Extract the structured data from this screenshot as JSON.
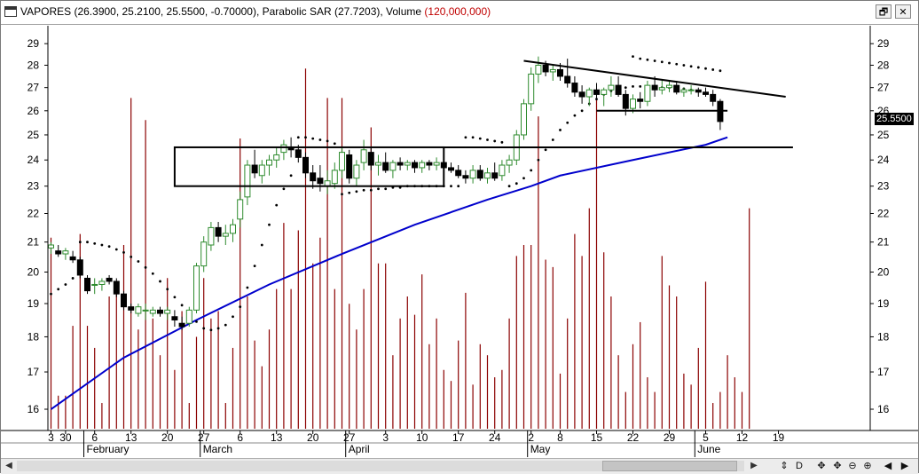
{
  "window": {
    "title_prefix": "VAPORES (26.3900, 25.2100, 25.5500, -0.70000), Parabolic SAR (27.7203), Volume ",
    "title_volume": "(120,000,000)",
    "restore_label": "🗗",
    "close_label": "✕"
  },
  "price_tag": "25.5500",
  "scrollbar": {
    "left_label": "◀",
    "right_label": "▶",
    "tools": [
      "⇕",
      "D",
      "✥",
      "✥",
      "⊖",
      "⊕",
      "◀",
      "▶"
    ]
  },
  "chart_data": {
    "type": "candlestick",
    "ylim": [
      15.5,
      29.6
    ],
    "y_scale": "log",
    "y_ticks": [
      16,
      17,
      18,
      19,
      20,
      21,
      22,
      23,
      24,
      25,
      26,
      27,
      28,
      29
    ],
    "y_ticks_right": [
      16,
      17,
      18,
      19,
      20,
      21,
      22,
      23,
      24,
      25,
      26,
      27,
      28,
      29
    ],
    "x_tick_labels": [
      "3",
      "30",
      "6",
      "13",
      "20",
      "27",
      "6",
      "13",
      "20",
      "27",
      "3",
      "10",
      "17",
      "24",
      "2",
      "8",
      "15",
      "22",
      "29",
      "5",
      "12",
      "19"
    ],
    "x_tick_bars": [
      0,
      2,
      6,
      11,
      16,
      21,
      26,
      31,
      36,
      41,
      46,
      51,
      56,
      61,
      66,
      70,
      75,
      80,
      85,
      90,
      95,
      100
    ],
    "months": [
      {
        "label": "February",
        "bar": 5
      },
      {
        "label": "March",
        "bar": 21
      },
      {
        "label": "April",
        "bar": 41
      },
      {
        "label": "May",
        "bar": 66
      },
      {
        "label": "June",
        "bar": 89
      }
    ],
    "series": [
      {
        "name": "VAPORES",
        "ohlc": [
          [
            20.8,
            21.0,
            20.6,
            20.9
          ],
          [
            20.7,
            20.9,
            20.5,
            20.6
          ],
          [
            20.6,
            20.8,
            20.4,
            20.7
          ],
          [
            20.5,
            20.7,
            20.3,
            20.4
          ],
          [
            20.4,
            20.5,
            19.8,
            19.9
          ],
          [
            19.8,
            19.9,
            19.3,
            19.4
          ],
          [
            19.6,
            19.8,
            19.3,
            19.6
          ],
          [
            19.6,
            19.8,
            19.4,
            19.7
          ],
          [
            19.8,
            19.9,
            19.6,
            19.7
          ],
          [
            19.7,
            19.8,
            19.2,
            19.3
          ],
          [
            19.3,
            19.4,
            18.8,
            18.9
          ],
          [
            18.9,
            19.0,
            18.7,
            18.8
          ],
          [
            18.7,
            19.0,
            18.6,
            18.9
          ],
          [
            18.8,
            19.0,
            18.5,
            18.8
          ],
          [
            18.7,
            18.9,
            18.6,
            18.8
          ],
          [
            18.8,
            18.9,
            18.6,
            18.7
          ],
          [
            18.7,
            18.9,
            18.5,
            18.8
          ],
          [
            18.6,
            18.8,
            18.3,
            18.5
          ],
          [
            18.4,
            18.6,
            18.2,
            18.3
          ],
          [
            18.4,
            18.9,
            18.3,
            18.8
          ],
          [
            18.8,
            20.3,
            18.7,
            20.2
          ],
          [
            20.2,
            21.2,
            20.0,
            21.0
          ],
          [
            20.9,
            21.7,
            20.7,
            21.5
          ],
          [
            21.5,
            21.7,
            21.0,
            21.2
          ],
          [
            21.2,
            21.6,
            20.9,
            21.3
          ],
          [
            21.3,
            21.8,
            21.0,
            21.6
          ],
          [
            21.8,
            22.8,
            21.5,
            22.5
          ],
          [
            22.6,
            24.0,
            22.3,
            23.8
          ],
          [
            23.8,
            24.4,
            23.3,
            23.5
          ],
          [
            23.4,
            24.0,
            23.1,
            23.8
          ],
          [
            23.8,
            24.2,
            23.4,
            24.0
          ],
          [
            24.0,
            24.5,
            23.7,
            24.2
          ],
          [
            24.3,
            24.8,
            24.0,
            24.6
          ],
          [
            24.5,
            24.9,
            24.1,
            24.4
          ],
          [
            24.4,
            24.6,
            23.9,
            24.1
          ],
          [
            24.1,
            24.3,
            23.3,
            23.5
          ],
          [
            23.5,
            23.8,
            22.9,
            23.2
          ],
          [
            23.3,
            23.8,
            22.8,
            23.1
          ],
          [
            23.0,
            23.6,
            22.7,
            23.2
          ],
          [
            23.1,
            23.9,
            22.9,
            23.6
          ],
          [
            23.6,
            24.5,
            23.3,
            24.3
          ],
          [
            24.2,
            24.4,
            23.1,
            23.3
          ],
          [
            23.3,
            24.0,
            23.0,
            23.8
          ],
          [
            23.9,
            24.8,
            23.6,
            24.4
          ],
          [
            24.3,
            24.5,
            23.6,
            23.8
          ],
          [
            23.8,
            24.2,
            23.4,
            23.9
          ],
          [
            23.9,
            24.3,
            23.5,
            23.6
          ],
          [
            23.6,
            24.0,
            23.3,
            23.9
          ],
          [
            23.9,
            24.1,
            23.6,
            23.8
          ],
          [
            23.8,
            24.0,
            23.6,
            23.9
          ],
          [
            23.9,
            24.0,
            23.5,
            23.7
          ],
          [
            23.7,
            24.0,
            23.5,
            23.9
          ],
          [
            23.9,
            24.0,
            23.6,
            23.8
          ],
          [
            23.8,
            24.1,
            23.6,
            23.9
          ],
          [
            23.9,
            24.0,
            23.6,
            23.7
          ],
          [
            23.7,
            23.9,
            23.5,
            23.6
          ],
          [
            23.6,
            23.8,
            23.3,
            23.4
          ],
          [
            23.4,
            23.6,
            23.1,
            23.3
          ],
          [
            23.3,
            23.8,
            23.1,
            23.6
          ],
          [
            23.6,
            23.8,
            23.2,
            23.3
          ],
          [
            23.3,
            23.7,
            23.1,
            23.5
          ],
          [
            23.5,
            23.9,
            23.2,
            23.3
          ],
          [
            23.4,
            24.0,
            23.2,
            23.8
          ],
          [
            23.8,
            24.2,
            23.5,
            24.0
          ],
          [
            24.0,
            25.2,
            23.8,
            25.0
          ],
          [
            25.0,
            26.5,
            24.8,
            26.3
          ],
          [
            26.3,
            27.9,
            26.0,
            27.6
          ],
          [
            27.6,
            28.4,
            27.2,
            28.0
          ],
          [
            28.0,
            28.2,
            27.5,
            27.7
          ],
          [
            27.7,
            28.0,
            27.3,
            27.8
          ],
          [
            27.8,
            28.1,
            27.3,
            27.5
          ],
          [
            27.5,
            28.3,
            27.0,
            27.2
          ],
          [
            27.2,
            27.5,
            26.6,
            26.8
          ],
          [
            26.8,
            27.1,
            26.3,
            26.6
          ],
          [
            26.6,
            27.0,
            26.2,
            26.9
          ],
          [
            26.9,
            27.2,
            26.5,
            26.7
          ],
          [
            26.7,
            27.0,
            26.2,
            26.9
          ],
          [
            26.9,
            27.5,
            26.6,
            27.1
          ],
          [
            27.1,
            27.5,
            26.6,
            26.7
          ],
          [
            26.7,
            26.9,
            25.8,
            26.1
          ],
          [
            26.1,
            26.7,
            25.9,
            26.5
          ],
          [
            26.5,
            26.8,
            26.1,
            26.4
          ],
          [
            26.4,
            27.3,
            26.2,
            27.1
          ],
          [
            27.1,
            27.5,
            26.6,
            26.9
          ],
          [
            26.9,
            27.3,
            26.7,
            27.0
          ],
          [
            27.0,
            27.3,
            26.8,
            27.1
          ],
          [
            27.1,
            27.3,
            26.7,
            26.8
          ],
          [
            26.8,
            27.0,
            26.6,
            26.9
          ],
          [
            26.9,
            27.1,
            26.7,
            26.9
          ],
          [
            26.9,
            27.0,
            26.6,
            26.8
          ],
          [
            26.8,
            27.0,
            26.6,
            26.7
          ],
          [
            26.7,
            26.9,
            26.2,
            26.4
          ],
          [
            26.4,
            26.5,
            25.2,
            25.55
          ]
        ]
      },
      {
        "name": "Parabolic SAR",
        "points": [
          [
            0,
            19.3
          ],
          [
            1,
            19.45
          ],
          [
            2,
            19.6
          ],
          [
            3,
            19.8
          ],
          [
            4,
            21.0
          ],
          [
            5,
            21.0
          ],
          [
            6,
            20.95
          ],
          [
            7,
            20.9
          ],
          [
            8,
            20.85
          ],
          [
            9,
            20.75
          ],
          [
            10,
            20.65
          ],
          [
            11,
            20.5
          ],
          [
            12,
            20.35
          ],
          [
            13,
            20.15
          ],
          [
            14,
            19.95
          ],
          [
            15,
            19.7
          ],
          [
            16,
            19.45
          ],
          [
            17,
            19.2
          ],
          [
            18,
            18.95
          ],
          [
            19,
            18.7
          ],
          [
            20,
            18.45
          ],
          [
            21,
            18.25
          ],
          [
            22,
            18.2
          ],
          [
            23,
            18.25
          ],
          [
            24,
            18.35
          ],
          [
            25,
            18.6
          ],
          [
            26,
            18.9
          ],
          [
            27,
            19.5
          ],
          [
            28,
            20.2
          ],
          [
            29,
            20.9
          ],
          [
            30,
            21.6
          ],
          [
            31,
            22.3
          ],
          [
            32,
            22.9
          ],
          [
            33,
            23.4
          ],
          [
            34,
            24.9
          ],
          [
            35,
            24.9
          ],
          [
            36,
            24.85
          ],
          [
            37,
            24.8
          ],
          [
            38,
            24.75
          ],
          [
            39,
            24.65
          ],
          [
            40,
            22.7
          ],
          [
            41,
            22.75
          ],
          [
            42,
            22.8
          ],
          [
            43,
            22.85
          ],
          [
            44,
            22.85
          ],
          [
            45,
            22.9
          ],
          [
            46,
            22.9
          ],
          [
            47,
            22.95
          ],
          [
            48,
            22.95
          ],
          [
            49,
            23.0
          ],
          [
            50,
            23.0
          ],
          [
            51,
            23.0
          ],
          [
            52,
            23.0
          ],
          [
            53,
            23.0
          ],
          [
            54,
            23.0
          ],
          [
            55,
            23.0
          ],
          [
            56,
            23.0
          ],
          [
            57,
            24.9
          ],
          [
            58,
            24.9
          ],
          [
            59,
            24.85
          ],
          [
            60,
            24.8
          ],
          [
            61,
            24.75
          ],
          [
            62,
            24.7
          ],
          [
            63,
            23.0
          ],
          [
            64,
            23.1
          ],
          [
            65,
            23.3
          ],
          [
            66,
            23.6
          ],
          [
            67,
            24.0
          ],
          [
            68,
            24.4
          ],
          [
            69,
            24.8
          ],
          [
            70,
            25.2
          ],
          [
            71,
            25.5
          ],
          [
            72,
            25.8
          ],
          [
            73,
            26.0
          ],
          [
            74,
            26.3
          ],
          [
            75,
            26.5
          ],
          [
            76,
            26.7
          ],
          [
            77,
            26.85
          ],
          [
            78,
            26.95
          ],
          [
            79,
            27.0
          ],
          [
            80,
            27.05
          ],
          [
            81,
            27.05
          ],
          [
            82,
            27.05
          ],
          [
            83,
            27.0
          ],
          [
            84,
            27.0
          ],
          [
            85,
            27.0
          ],
          [
            86,
            26.95
          ],
          [
            87,
            26.95
          ],
          [
            88,
            26.9
          ],
          [
            89,
            26.85
          ],
          [
            80,
            28.4
          ],
          [
            81,
            28.3
          ],
          [
            82,
            28.25
          ],
          [
            83,
            28.2
          ],
          [
            84,
            28.15
          ],
          [
            85,
            28.1
          ],
          [
            86,
            28.05
          ],
          [
            87,
            28.0
          ],
          [
            88,
            27.95
          ],
          [
            89,
            27.9
          ],
          [
            90,
            27.85
          ],
          [
            91,
            27.8
          ],
          [
            92,
            27.75
          ]
        ]
      },
      {
        "name": "Moving Average",
        "points": [
          [
            0,
            16.0
          ],
          [
            10,
            17.4
          ],
          [
            20,
            18.5
          ],
          [
            30,
            19.6
          ],
          [
            40,
            20.6
          ],
          [
            50,
            21.6
          ],
          [
            60,
            22.5
          ],
          [
            66,
            23.0
          ],
          [
            70,
            23.4
          ],
          [
            80,
            24.0
          ],
          [
            90,
            24.6
          ],
          [
            93,
            24.9
          ]
        ]
      },
      {
        "name": "Volume",
        "values": [
          0.52,
          0.09,
          0.09,
          0.28,
          0.53,
          0.28,
          0.22,
          0.07,
          0.36,
          0.37,
          0.5,
          0.9,
          0.27,
          0.84,
          0.3,
          0.2,
          0.41,
          0.16,
          0.32,
          0.07,
          0.25,
          0.41,
          0.3,
          0.32,
          0.07,
          0.22,
          0.79,
          0.36,
          0.24,
          0.17,
          0.27,
          0.38,
          0.56,
          0.38,
          0.54,
          0.98,
          0.45,
          0.52,
          0.9,
          0.38,
          0.9,
          0.34,
          0.27,
          0.38,
          0.82,
          0.45,
          0.45,
          0.2,
          0.3,
          0.36,
          0.31,
          0.42,
          0.23,
          0.3,
          0.16,
          0.13,
          0.24,
          0.37,
          0.12,
          0.23,
          0.2,
          0.14,
          0.16,
          0.3,
          0.47,
          0.5,
          0.5,
          0.85,
          0.46,
          0.44,
          0.15,
          0.3,
          0.53,
          0.47,
          0.6,
          0.9,
          0.48,
          0.36,
          0.2,
          0.1,
          0.23,
          0.29,
          0.14,
          0.1,
          0.47,
          0.39,
          0.36,
          0.15,
          0.12,
          0.22,
          0.4,
          0.07,
          0.1,
          0.2,
          0.14,
          0.1,
          0.6
        ]
      }
    ],
    "annotations": [
      {
        "type": "rectangle",
        "from": [
          17,
          24.5
        ],
        "to": [
          54,
          23.0
        ]
      },
      {
        "type": "line",
        "from": [
          54,
          24.5
        ],
        "to": [
          102,
          24.5
        ]
      },
      {
        "type": "line",
        "from": [
          75,
          26.0
        ],
        "to": [
          93,
          26.0
        ]
      },
      {
        "type": "line",
        "from": [
          65,
          28.2
        ],
        "to": [
          101,
          26.6
        ]
      }
    ],
    "legend": "none",
    "grid": false
  }
}
